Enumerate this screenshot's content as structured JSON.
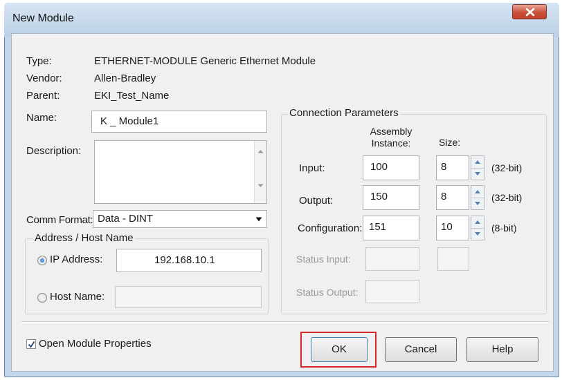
{
  "window": {
    "title": "New Module"
  },
  "info": {
    "type_label": "Type:",
    "type_value": "ETHERNET-MODULE Generic Ethernet Module",
    "vendor_label": "Vendor:",
    "vendor_value": "Allen-Bradley",
    "parent_label": "Parent:",
    "parent_value": "EKI_Test_Name"
  },
  "form": {
    "name_label": "Name:",
    "name_value": "K _ Module1",
    "description_label": "Description:",
    "description_value": "",
    "comm_format_label": "Comm Format:",
    "comm_format_value": "Data - DINT"
  },
  "address": {
    "group_label": "Address / Host Name",
    "ip_label": "IP Address:",
    "ip_value": "192.168.10.1",
    "ip_selected": true,
    "host_label": "Host Name:",
    "host_value": "",
    "host_selected": false
  },
  "connection": {
    "group_label": "Connection Parameters",
    "col_assembly": "Assembly\nInstance:",
    "col_size": "Size:",
    "rows": [
      {
        "label": "Input:",
        "instance": "100",
        "size": "8",
        "unit": "(32-bit)"
      },
      {
        "label": "Output:",
        "instance": "150",
        "size": "8",
        "unit": "(32-bit)"
      },
      {
        "label": "Configuration:",
        "instance": "151",
        "size": "10",
        "unit": "(8-bit)"
      }
    ],
    "status_input_label": "Status Input:",
    "status_output_label": "Status Output:"
  },
  "footer": {
    "open_props_label": "Open Module Properties",
    "open_props_checked": true,
    "ok": "OK",
    "cancel": "Cancel",
    "help": "Help"
  },
  "colors": {
    "highlight_border": "#d6262a",
    "radio_dot": "#1a66c2"
  }
}
